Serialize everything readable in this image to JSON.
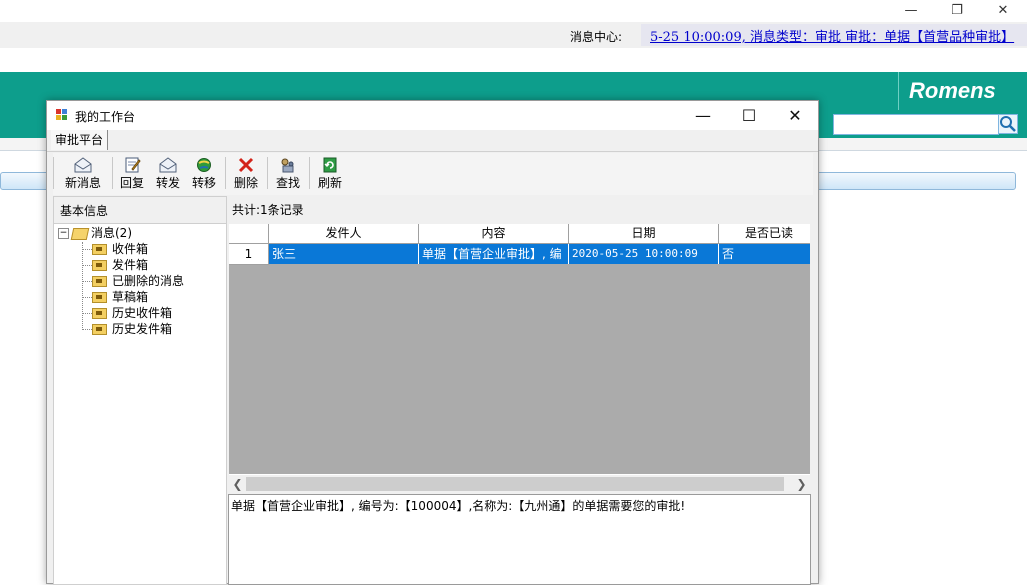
{
  "message_center": {
    "label": "消息中心:",
    "marquee": "5-25 10:00:09, 消息类型：审批  审批：单据【首营品种审批】"
  },
  "brand": {
    "logo_text": "Romens"
  },
  "dialog": {
    "title": "我的工作台",
    "tab": "审批平台",
    "toolbar": {
      "new_message": "新消息",
      "reply": "回复",
      "forward": "转发",
      "transfer": "转移",
      "delete": "删除",
      "find": "查找",
      "refresh": "刷新"
    },
    "left_panel": {
      "header": "基本信息",
      "tree": {
        "root": "消息(2)",
        "children": [
          "收件箱",
          "发件箱",
          "已删除的消息",
          "草稿箱",
          "历史收件箱",
          "历史发件箱"
        ]
      }
    },
    "record_count": "共计:1条记录",
    "grid": {
      "columns": [
        "发件人",
        "内容",
        "日期",
        "是否已读"
      ],
      "rows": [
        {
          "index": "1",
          "sender": "张三",
          "content": "单据【首营企业审批】, 编",
          "date": "2020-05-25 10:00:09",
          "read": "否"
        }
      ]
    },
    "detail_text": "单据【首营企业审批】, 编号为:【100004】,名称为:【九州通】的单据需要您的审批!"
  }
}
